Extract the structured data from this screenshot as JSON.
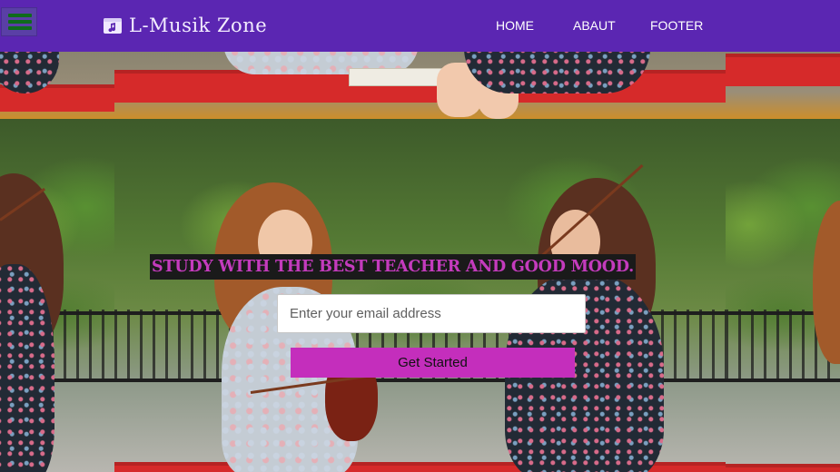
{
  "navbar": {
    "menu_icon": "hamburger-icon",
    "brand_icon": "music-folder-icon",
    "brand": "L-Musik Zone",
    "links": [
      "HOME",
      "ABAUT",
      "FOOTER"
    ]
  },
  "hero": {
    "headline": "STUDY WITH THE BEST TEACHER AND GOOD MOOD.",
    "email_placeholder": "Enter your email address",
    "email_value": "",
    "cta": "Get Started"
  },
  "colors": {
    "navbar": "#5b26b2",
    "accent": "#c42ebc",
    "headline_text": "#c43bbd",
    "hamburger_bars": "#0f6b1c"
  }
}
